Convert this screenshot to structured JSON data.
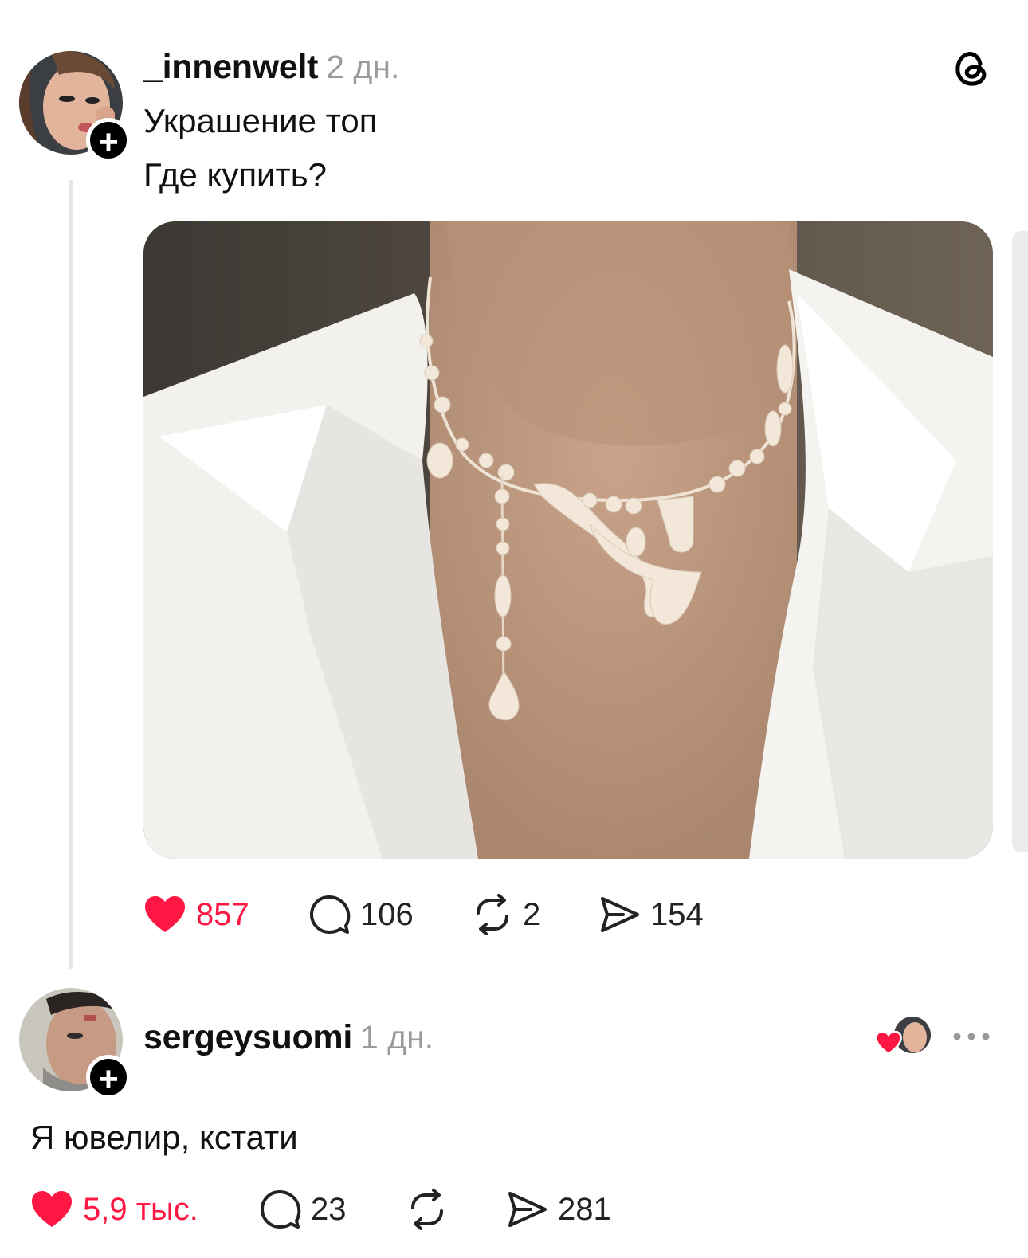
{
  "post": {
    "username": "_innenwelt",
    "time": "2 дн.",
    "text_line1": "Украшение топ",
    "text_line2": "Где купить?",
    "image_icon": "necklace-photo",
    "actions": {
      "likes": "857",
      "comments": "106",
      "reposts": "2",
      "shares": "154"
    }
  },
  "reply": {
    "username": "sergeysuomi",
    "time": "1 дн.",
    "text": "Я ювелир, кстати",
    "actions": {
      "likes": "5,9 тыс.",
      "comments": "23",
      "shares": "281"
    }
  },
  "icons": {
    "app_logo": "threads-logo-icon",
    "follow": "plus-icon",
    "like": "heart-icon",
    "comment": "comment-bubble-icon",
    "repost": "repost-icon",
    "share": "send-icon",
    "more": "more-dots-icon"
  },
  "colors": {
    "like_red": "#ff1744",
    "time_gray": "#9a9a9a"
  }
}
